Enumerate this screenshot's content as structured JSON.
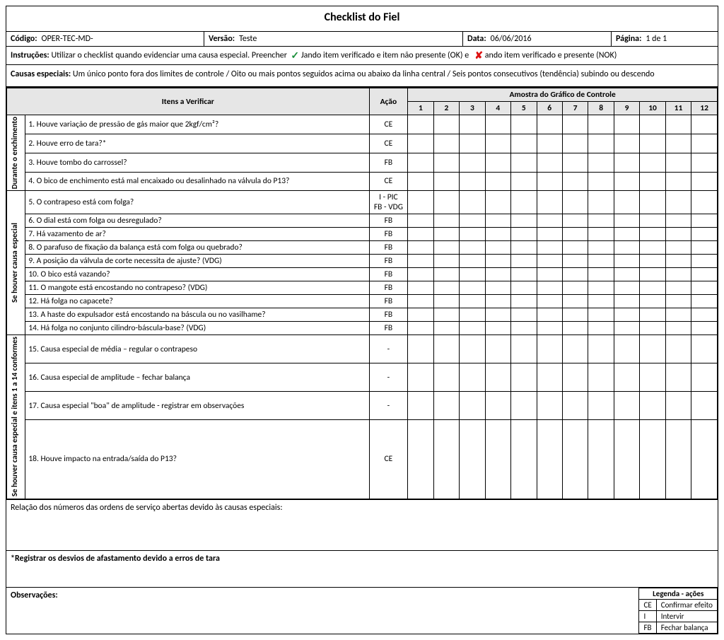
{
  "title": "Checklist do Fiel",
  "meta": {
    "codigo_label": "Código:",
    "codigo": "OPER-TEC-MD-",
    "versao_label": "Versão:",
    "versao": "Teste",
    "data_label": "Data:",
    "data": "06/06/2016",
    "pagina_label": "Página:",
    "pagina": "1 de 1"
  },
  "instrucoes": {
    "label": "Instruções:",
    "body": "Utilizar o checklist quando evidenciar uma causa especial. Preencher",
    "ok_text": "Jando item verificado e item não presente (OK) e",
    "nok_text": "ando item verificado e presente (NOK)"
  },
  "causas": {
    "label": "Causas especiais:",
    "body": "Um único ponto fora dos limites de controle / Oito ou mais pontos seguidos acima ou abaixo da linha central / Seis pontos consecutivos (tendência) subindo ou descendo"
  },
  "headers": {
    "itens": "Itens a Verificar",
    "acao": "Ação",
    "amostra": "Amostra do Gráfico de Controle",
    "samples": [
      "1",
      "2",
      "3",
      "4",
      "5",
      "6",
      "7",
      "8",
      "9",
      "10",
      "11",
      "12"
    ]
  },
  "sections": [
    {
      "label": "Durante o\n enchimento",
      "rows": [
        {
          "text": "1.  Houve variação de pressão de gás maior que 2kgf/cm²?",
          "acao": "CE"
        },
        {
          "text": "2.  Houve erro de tara?*",
          "acao": "CE"
        },
        {
          "text": "3.  Houve tombo do carrossel?",
          "acao": "FB"
        },
        {
          "text": "4.  O bico de enchimento está mal encaixado ou desalinhado na válvula do P13?",
          "acao": "CE"
        }
      ]
    },
    {
      "label": "Se houver causa especial",
      "rows": [
        {
          "text": "5.  O contrapeso está com folga?",
          "acao": "I - PIC\nFB - VDG"
        },
        {
          "text": "6.  O dial está com folga ou desregulado?",
          "acao": "FB"
        },
        {
          "text": "7.  Há vazamento de ar?",
          "acao": "FB"
        },
        {
          "text": "8.  O parafuso de fixação da balança está com folga ou quebrado?",
          "acao": "FB"
        },
        {
          "text": "9.  A posição da válvula de corte necessita de ajuste? (VDG)",
          "acao": "FB"
        },
        {
          "text": "10.  O bico está vazando?",
          "acao": "FB"
        },
        {
          "text": "11.  O mangote está encostando no contrapeso? (VDG)",
          "acao": "FB"
        },
        {
          "text": "12.  Há folga no capacete?",
          "acao": "FB"
        },
        {
          "text": "13.  A haste do expulsador está encostando na báscula ou no vasilhame?",
          "acao": "FB"
        },
        {
          "text": "14.  Há folga no conjunto cilindro-báscula-base? (VDG)",
          "acao": "FB"
        }
      ]
    },
    {
      "label": "Se houver causa especial\n e itens 1 a 14 conformes",
      "rows": [
        {
          "text": "15.  Causa especial de média – regular o contrapeso",
          "acao": "-",
          "tall": true
        },
        {
          "text": "16.  Causa especial de amplitude –  fechar balança",
          "acao": "-",
          "tall": true
        },
        {
          "text": "17.  Causa especial \"boa\" de amplitude - registrar em observações",
          "acao": "-",
          "tall": true
        },
        {
          "text": "18.  Houve impacto na entrada/saída do P13?",
          "acao": "CE"
        }
      ]
    }
  ],
  "relacao_label": "Relação dos números das ordens de serviço abertas devido às causas especiais:",
  "nota_tara": "*Registrar os desvios de afastamento devido a erros de tara",
  "obs_label": "Observações:",
  "legend": {
    "title": "Legenda - ações",
    "rows": [
      {
        "code": "CE",
        "desc": "Confirmar efeito"
      },
      {
        "code": "I",
        "desc": "Intervir"
      },
      {
        "code": "FB",
        "desc": "Fechar balança"
      }
    ]
  }
}
